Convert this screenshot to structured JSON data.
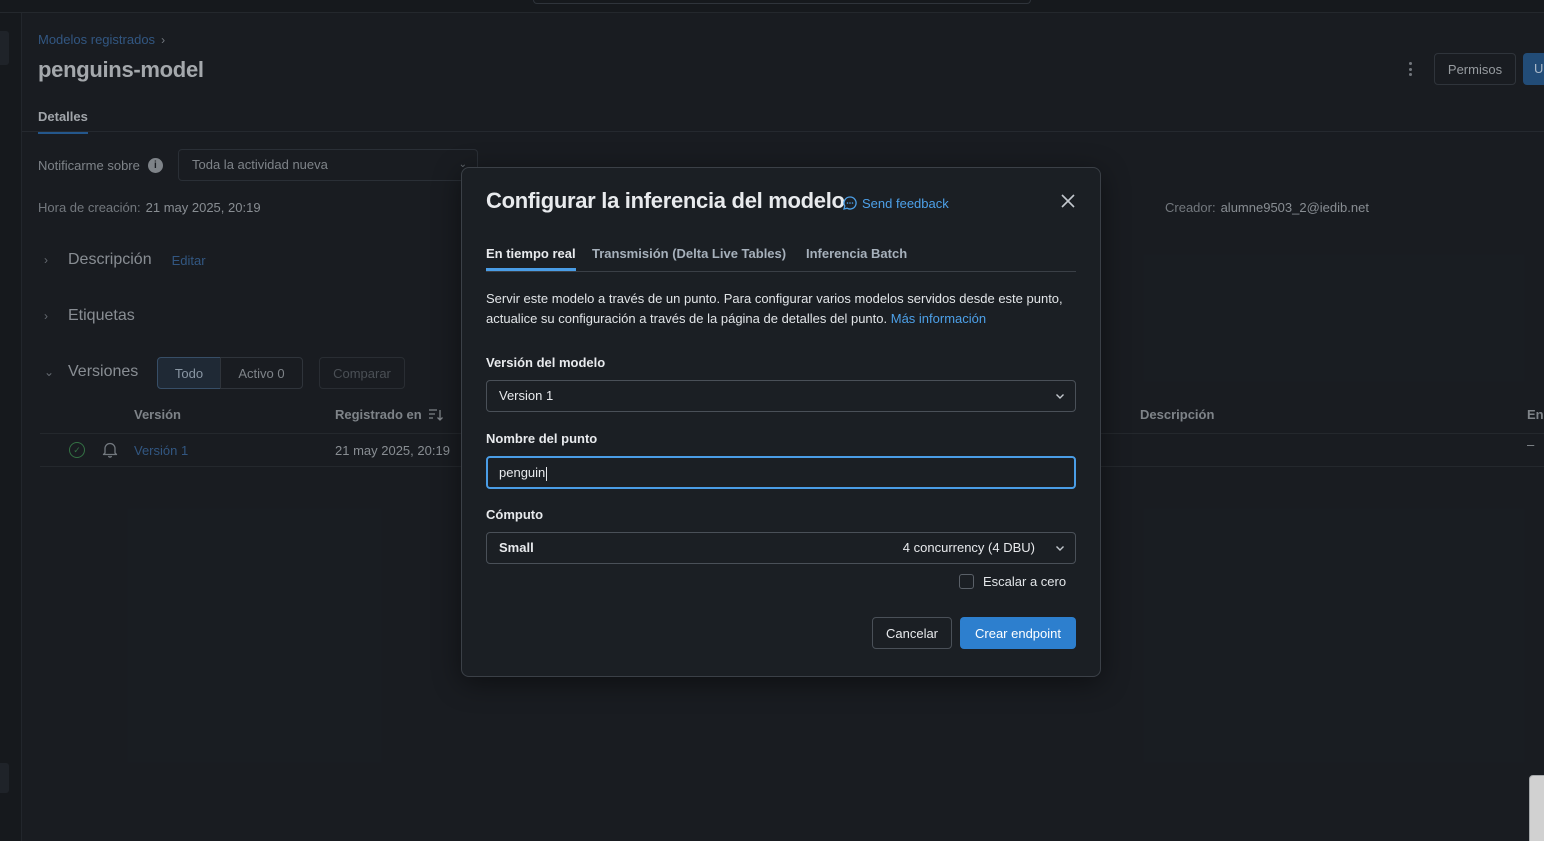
{
  "breadcrumb": {
    "parent": "Modelos registrados"
  },
  "page": {
    "title": "penguins-model"
  },
  "header_actions": {
    "permissions": "Permisos",
    "primary_partial": "U"
  },
  "tabs": {
    "details": "Detalles"
  },
  "notifications": {
    "label": "Notificarme sobre",
    "info_glyph": "i",
    "value": "Toda la actividad nueva"
  },
  "meta": {
    "created_label": "Hora de creación:",
    "created_value": "21 may 2025, 20:19",
    "creator_label": "Creador:",
    "creator_value": "alumne9503_2@iedib.net"
  },
  "sections": {
    "description": "Descripción",
    "edit": "Editar",
    "tags": "Etiquetas",
    "versions": "Versiones"
  },
  "versions_filter": {
    "all": "Todo",
    "active": "Activo 0",
    "compare": "Comparar"
  },
  "versions_table": {
    "columns": [
      "Versión",
      "Registrado en",
      "Descripción",
      "En"
    ],
    "rows": [
      {
        "version": "Versión 1",
        "registered": "21 may 2025, 20:19",
        "last": "–",
        "status": "ready"
      }
    ]
  },
  "modal": {
    "title": "Configurar la inferencia del modelo",
    "feedback": "Send feedback",
    "tabs": [
      "En tiempo real",
      "Transmisión (Delta Live Tables)",
      "Inferencia Batch"
    ],
    "active_tab_index": 0,
    "description": "Servir este modelo a través de un punto. Para configurar varios modelos servidos desde este punto, actualice su configuración a través de la página de detalles del punto.",
    "more_info": "Más información",
    "model_version_label": "Versión del modelo",
    "model_version_value": "Version 1",
    "endpoint_name_label": "Nombre del punto",
    "endpoint_name_value": "penguin",
    "compute_label": "Cómputo",
    "compute_size": "Small",
    "compute_concurrency": "4 concurrency (4 DBU)",
    "scale_to_zero_label": "Escalar a cero",
    "scale_to_zero_checked": false,
    "cancel": "Cancelar",
    "create": "Crear endpoint"
  },
  "colors": {
    "accent": "#2d7fce",
    "link": "#4da0e8",
    "success": "#3f8a53"
  }
}
